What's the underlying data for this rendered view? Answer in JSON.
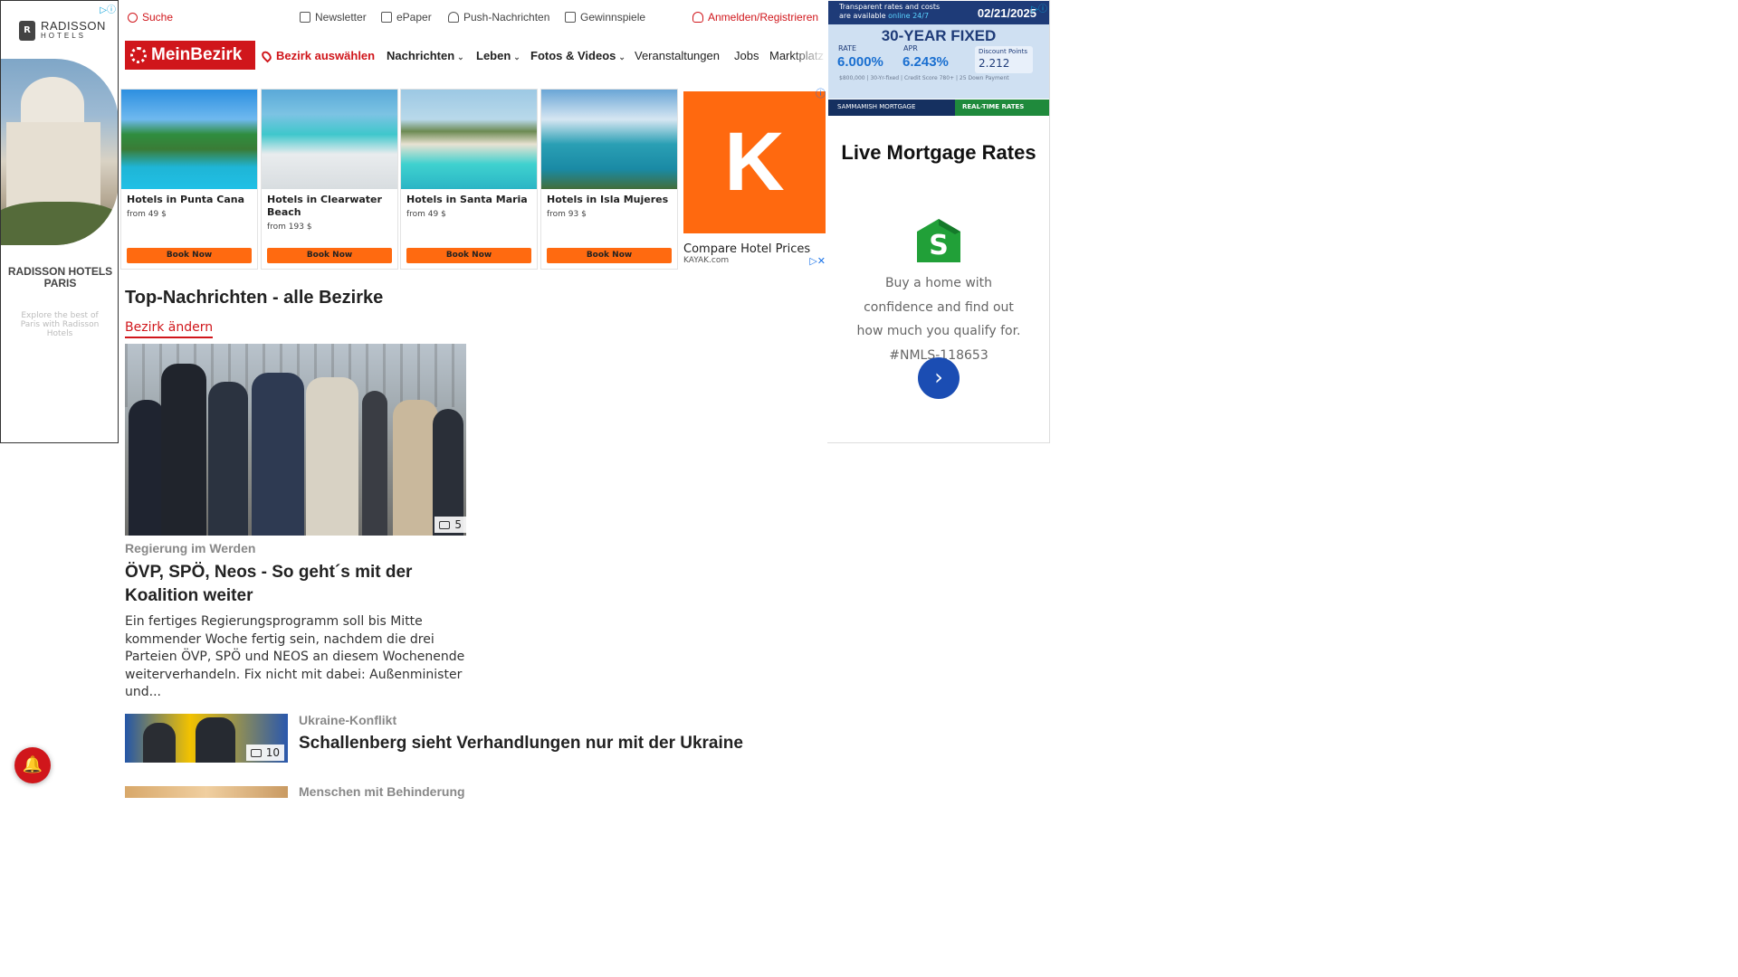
{
  "left_ad": {
    "brand": "RADISSON",
    "brand_sub": "HOTELS",
    "title": "RADISSON HOTELS PARIS",
    "subtitle": "Explore the best of Paris with Radisson Hotels"
  },
  "utility": {
    "search": "Suche",
    "newsletter": "Newsletter",
    "epaper": "ePaper",
    "push": "Push-Nachrichten",
    "contests": "Gewinnspiele",
    "login": "Anmelden/Registrieren"
  },
  "nav": {
    "brand": "MeinBezirk",
    "bezirk": "Bezirk auswählen",
    "items": [
      "Nachrichten",
      "Leben",
      "Fotos & Videos",
      "Veranstaltungen",
      "Jobs",
      "Marktplatz"
    ]
  },
  "hotel_ad": {
    "cards": [
      {
        "name": "Hotels in Punta Cana",
        "price": "from 49 $",
        "cta": "Book Now"
      },
      {
        "name": "Hotels in Clearwater Beach",
        "price": "from 193 $",
        "cta": "Book Now"
      },
      {
        "name": "Hotels in Santa Maria",
        "price": "from 49 $",
        "cta": "Book Now"
      },
      {
        "name": "Hotels in Isla Mujeres",
        "price": "from 93 $",
        "cta": "Book Now"
      }
    ],
    "kayak_letter": "K",
    "kayak_caption": "Compare Hotel Prices",
    "kayak_domain": "KAYAK.com"
  },
  "main": {
    "section_title": "Top-Nachrichten - alle Bezirke",
    "change_bezirk": "Bezirk ändern",
    "lead": {
      "image_count": "5",
      "kicker": "Regierung im Werden",
      "headline": "ÖVP, SPÖ, Neos - So geht´s mit der Koalition weiter",
      "teaser": "Ein fertiges Regierungsprogramm soll bis Mitte kommender Woche fertig sein, nachdem die drei Parteien ÖVP, SPÖ und NEOS an diesem Wochenende weiterverhandeln. Fix nicht mit dabei: Außenminister und..."
    },
    "articles": [
      {
        "image_count": "10",
        "kicker": "Ukraine-Konflikt",
        "headline": "Schallenberg sieht Verhandlungen nur mit der Ukraine"
      },
      {
        "kicker": "Menschen mit Behinderung"
      }
    ]
  },
  "right_ad": {
    "banner_tagline_1": "Transparent rates and costs",
    "banner_tagline_2": "are available",
    "banner_tagline_highlight": "online 24/7",
    "banner_date": "02/21/2025",
    "banner_title": "30-YEAR FIXED",
    "rate_label": "RATE",
    "rate_value": "6.000%",
    "apr_label": "APR",
    "apr_value": "6.243%",
    "points_label": "Discount Points",
    "points_value": "2.212",
    "fine_print": "$800,000 | 30-Yr-fixed | Credit Score 780+ | 25 Down Payment",
    "lender": "SAMMAMISH MORTGAGE",
    "cta_bar": "REAL-TIME RATES",
    "headline": "Live Mortgage Rates",
    "description": "Buy a home with confidence and find out how much you qualify for. #NMLS-118653"
  },
  "colors": {
    "brand_red": "#d0161b",
    "kayak_orange": "#ff690f",
    "ad_blue": "#1b4db3"
  }
}
